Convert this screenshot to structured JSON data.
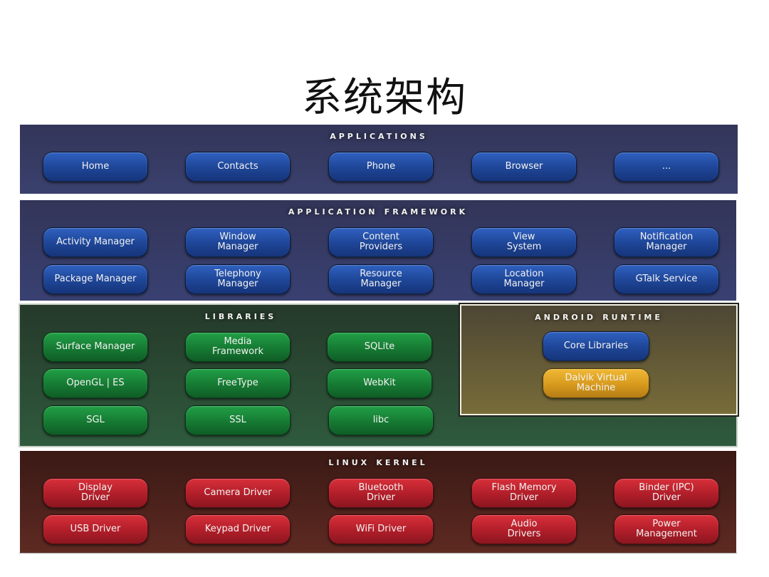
{
  "page": {
    "title": "系统架构"
  },
  "colors": {
    "applications_bg": "#363a63",
    "framework_bg": "#363a63",
    "libraries_bg": "#2b4a33",
    "runtime_bg": "#6b6039",
    "kernel_bg": "#4a211b",
    "blue_box": "#1e4596",
    "green_box": "#167a33",
    "red_box": "#b01e29",
    "gold_box": "#d79a1e"
  },
  "layers": {
    "applications": {
      "title": "Applications",
      "items": [
        "Home",
        "Contacts",
        "Phone",
        "Browser",
        "..."
      ]
    },
    "framework": {
      "title": "Application Framework",
      "items": [
        "Activity Manager",
        "Window\nManager",
        "Content\nProviders",
        "View\nSystem",
        "Notification\nManager",
        "Package Manager",
        "Telephony\nManager",
        "Resource\nManager",
        "Location\nManager",
        "GTalk Service"
      ]
    },
    "libraries": {
      "title": "Libraries",
      "items": [
        "Surface Manager",
        "Media\nFramework",
        "SQLite",
        "OpenGL | ES",
        "FreeType",
        "WebKit",
        "SGL",
        "SSL",
        "libc"
      ]
    },
    "runtime": {
      "title": "Android Runtime",
      "items": [
        "Core Libraries",
        "Dalvik Virtual\nMachine"
      ]
    },
    "kernel": {
      "title": "Linux Kernel",
      "items": [
        "Display\nDriver",
        "Camera Driver",
        "Bluetooth\nDriver",
        "Flash Memory\nDriver",
        "Binder (IPC)\nDriver",
        "USB Driver",
        "Keypad Driver",
        "WiFi Driver",
        "Audio\nDrivers",
        "Power\nManagement"
      ]
    }
  }
}
